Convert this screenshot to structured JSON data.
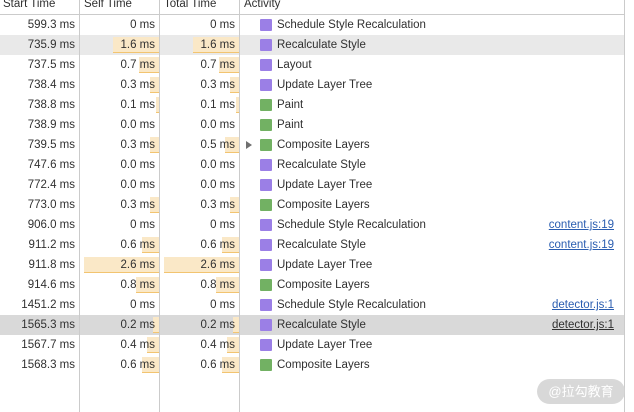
{
  "header": {
    "start_time": "Start Time",
    "self_time": "Self Time",
    "total_time": "Total Time",
    "activity": "Activity"
  },
  "colors": {
    "text": "#303030",
    "grid_line": "#cbcbcb",
    "selected_row": "#e9e9e9",
    "hovered_row": "#d9d9d9",
    "bar_fill": "#fae8c7",
    "bar_edge": "#f2c470",
    "link": "#2a5db0",
    "link_on_hovered_row": "#303030",
    "expand_triangle": "#6f6f6f",
    "rendering-icon": "#9b7fe6",
    "painting-icon": "#72b163",
    "watermark_bg": "#d2d2d2",
    "watermark_text": "#ffffff"
  },
  "rows": [
    {
      "start": "599.3 ms",
      "self": "0 ms",
      "total": "0 ms",
      "icon": "rendering-icon",
      "activity": "Schedule Style Recalculation"
    },
    {
      "start": "735.9 ms",
      "self": "1.6 ms",
      "total": "1.6 ms",
      "icon": "rendering-icon",
      "activity": "Recalculate Style",
      "selected": true
    },
    {
      "start": "737.5 ms",
      "self": "0.7 ms",
      "total": "0.7 ms",
      "icon": "rendering-icon",
      "activity": "Layout"
    },
    {
      "start": "738.4 ms",
      "self": "0.3 ms",
      "total": "0.3 ms",
      "icon": "rendering-icon",
      "activity": "Update Layer Tree"
    },
    {
      "start": "738.8 ms",
      "self": "0.1 ms",
      "total": "0.1 ms",
      "icon": "painting-icon",
      "activity": "Paint"
    },
    {
      "start": "738.9 ms",
      "self": "0.0 ms",
      "total": "0.0 ms",
      "icon": "painting-icon",
      "activity": "Paint"
    },
    {
      "start": "739.5 ms",
      "self": "0.3 ms",
      "total": "0.5 ms",
      "icon": "painting-icon",
      "activity": "Composite Layers",
      "expandable": true
    },
    {
      "start": "747.6 ms",
      "self": "0.0 ms",
      "total": "0.0 ms",
      "icon": "rendering-icon",
      "activity": "Recalculate Style"
    },
    {
      "start": "772.4 ms",
      "self": "0.0 ms",
      "total": "0.0 ms",
      "icon": "rendering-icon",
      "activity": "Update Layer Tree"
    },
    {
      "start": "773.0 ms",
      "self": "0.3 ms",
      "total": "0.3 ms",
      "icon": "painting-icon",
      "activity": "Composite Layers"
    },
    {
      "start": "906.0 ms",
      "self": "0 ms",
      "total": "0 ms",
      "icon": "rendering-icon",
      "activity": "Schedule Style Recalculation",
      "source": "content.js:19"
    },
    {
      "start": "911.2 ms",
      "self": "0.6 ms",
      "total": "0.6 ms",
      "icon": "rendering-icon",
      "activity": "Recalculate Style",
      "source": "content.js:19"
    },
    {
      "start": "911.8 ms",
      "self": "2.6 ms",
      "total": "2.6 ms",
      "icon": "rendering-icon",
      "activity": "Update Layer Tree"
    },
    {
      "start": "914.6 ms",
      "self": "0.8 ms",
      "total": "0.8 ms",
      "icon": "painting-icon",
      "activity": "Composite Layers"
    },
    {
      "start": "1451.2 ms",
      "self": "0 ms",
      "total": "0 ms",
      "icon": "rendering-icon",
      "activity": "Schedule Style Recalculation",
      "source": "detector.js:1"
    },
    {
      "start": "1565.3 ms",
      "self": "0.2 ms",
      "total": "0.2 ms",
      "icon": "rendering-icon",
      "activity": "Recalculate Style",
      "source": "detector.js:1",
      "hovered": true
    },
    {
      "start": "1567.7 ms",
      "self": "0.4 ms",
      "total": "0.4 ms",
      "icon": "rendering-icon",
      "activity": "Update Layer Tree"
    },
    {
      "start": "1568.3 ms",
      "self": "0.6 ms",
      "total": "0.6 ms",
      "icon": "painting-icon",
      "activity": "Composite Layers"
    }
  ],
  "watermark": "@拉勾教育"
}
